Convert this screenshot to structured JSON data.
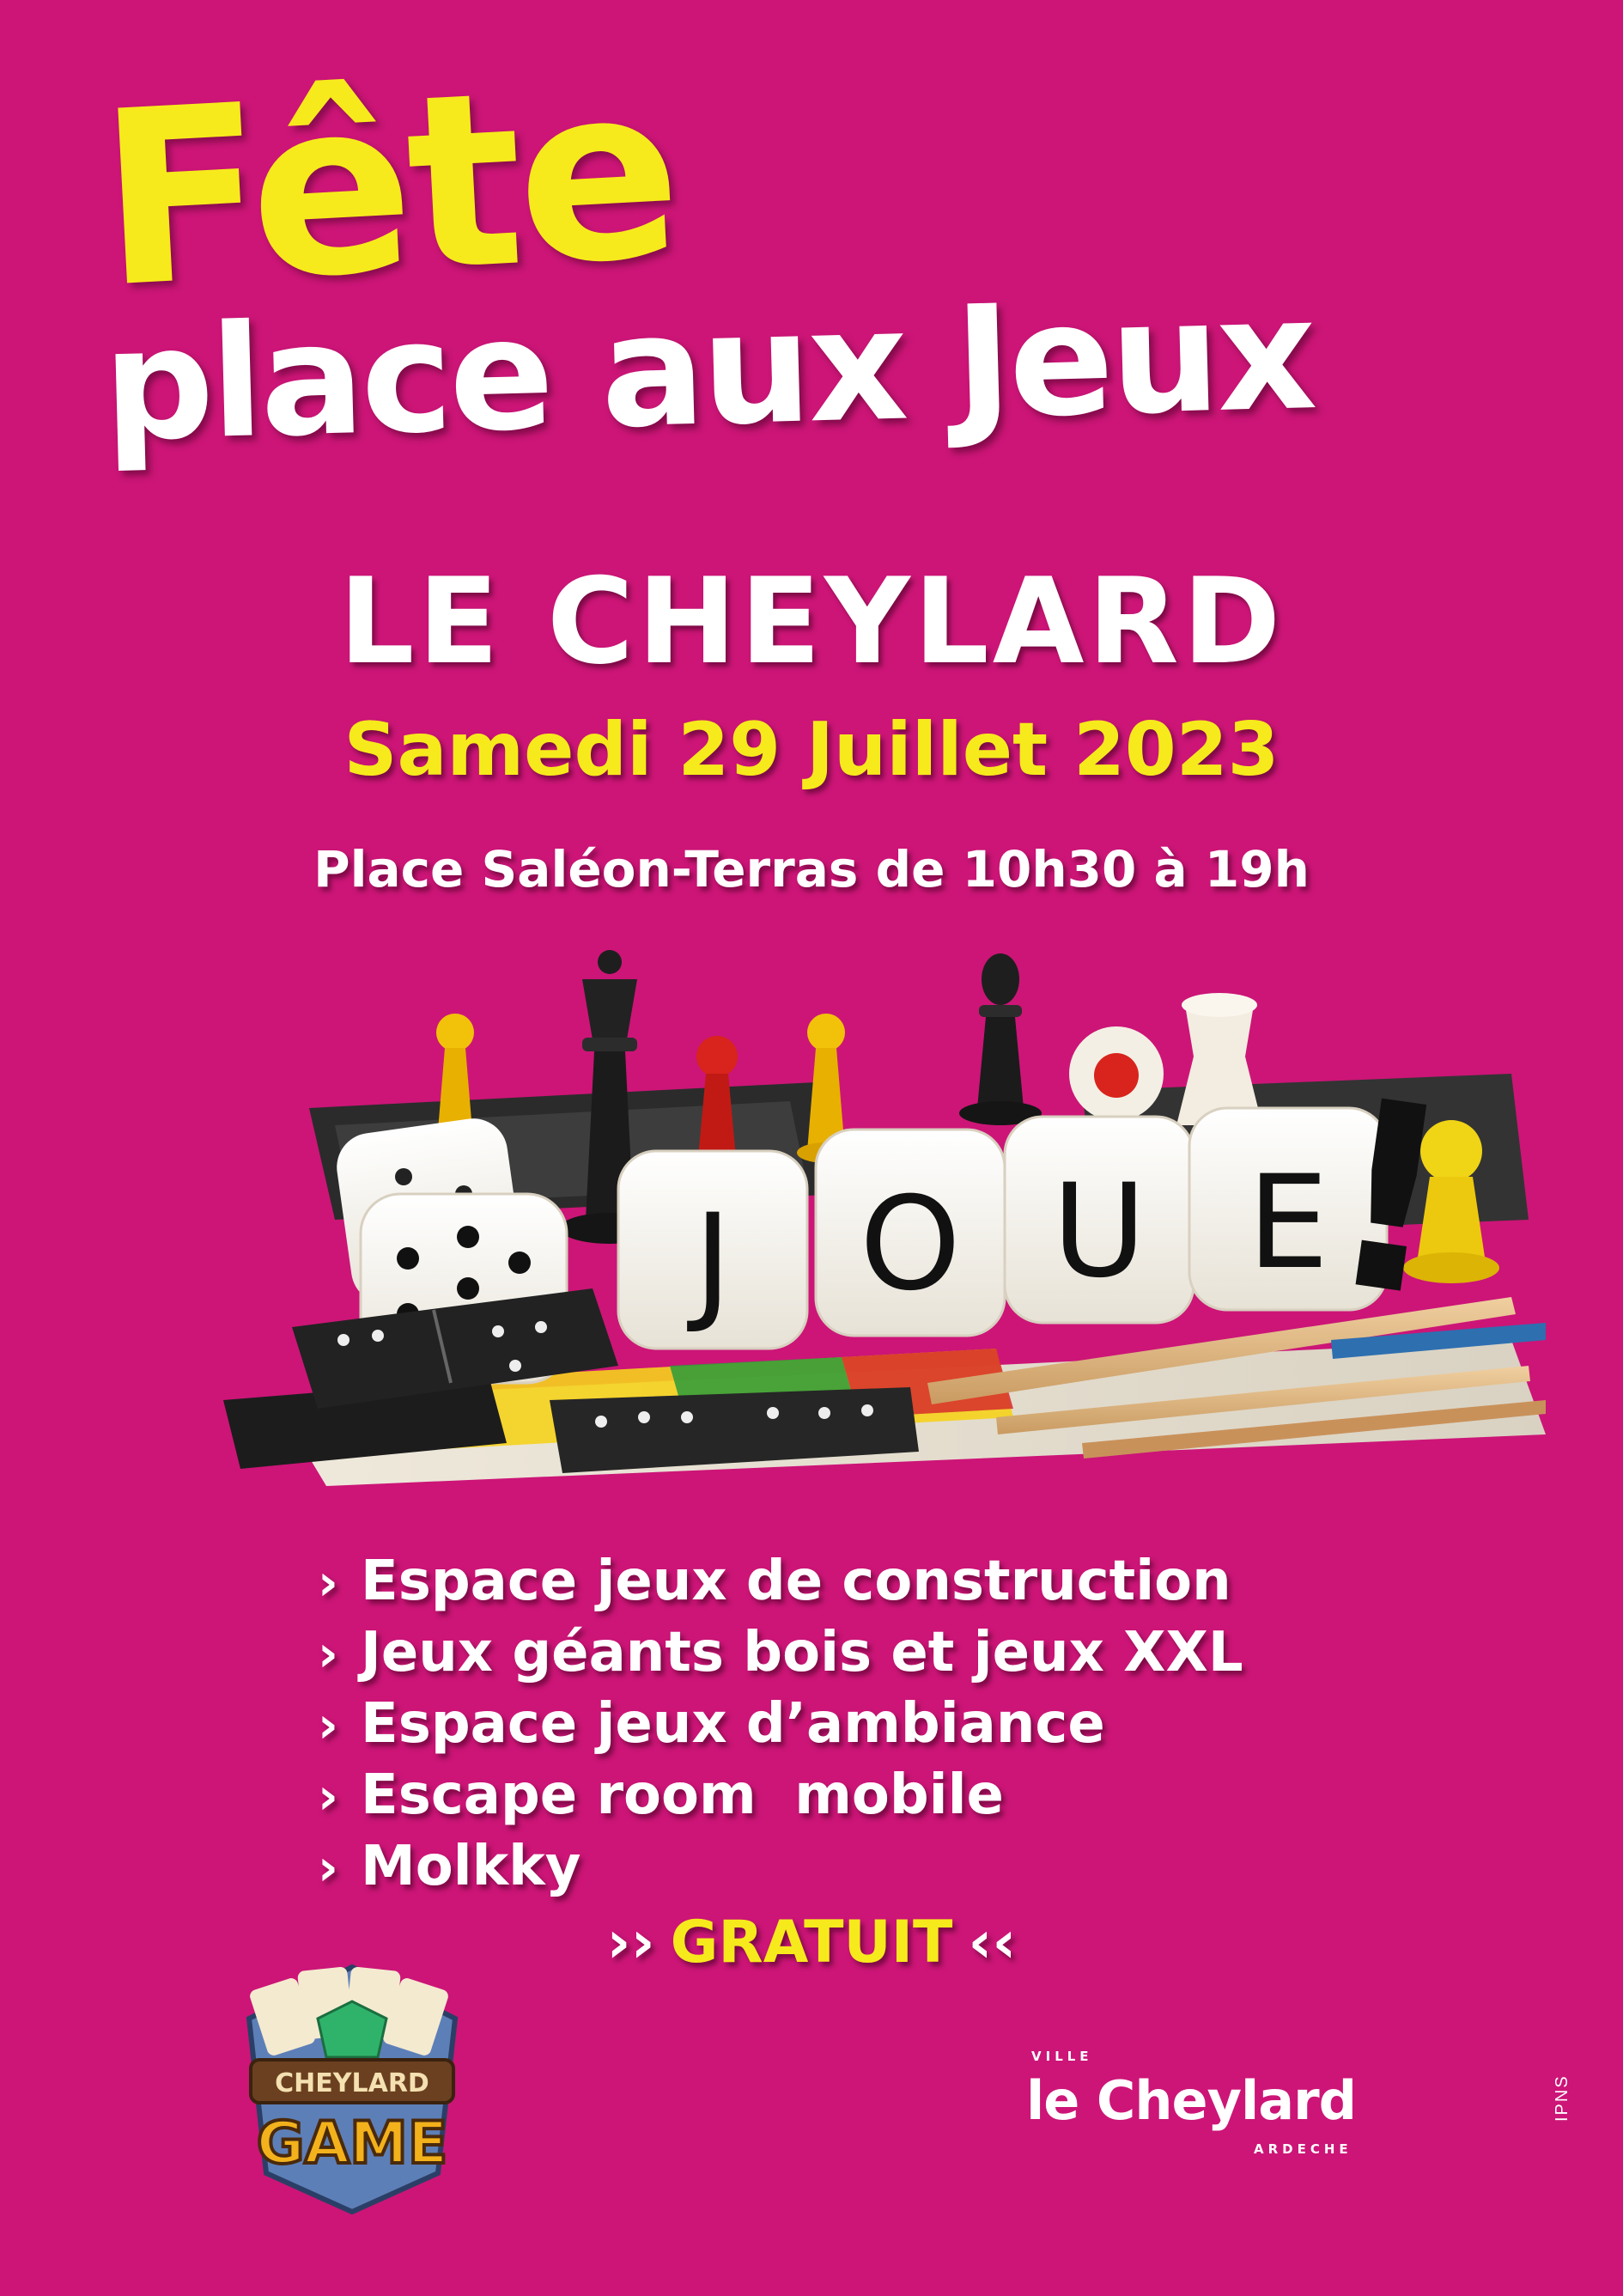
{
  "header": {
    "title_line1": "Fête",
    "title_line2": "place aux Jeux"
  },
  "event": {
    "town": "LE CHEYLARD",
    "date": "Samedi 29 Juillet 2023",
    "location": "Place Saléon-Terras de 10h30 à 19h"
  },
  "illustration": {
    "dice_letters": [
      "J",
      "O",
      "U",
      "E"
    ],
    "exclamation": "!"
  },
  "activities": {
    "bullet": "›",
    "items": [
      "Espace jeux de construction",
      "Jeux géants bois et jeux XXL",
      "Espace jeux d’ambiance",
      "Escape room  mobile",
      "Molkky"
    ]
  },
  "price": {
    "open_quote": "››",
    "label": "GRATUIT",
    "close_quote": "‹‹"
  },
  "logos": {
    "game_logo_line1": "CHEYLARD",
    "game_logo_line2": "GAME",
    "city_logo_top": "VILLE",
    "city_logo_name": "le Cheylard",
    "city_logo_bottom": "ARDECHE"
  },
  "footer": {
    "print_mention": "IPNS"
  },
  "colors": {
    "background": "#cc1577",
    "yellow": "#f7ea1c",
    "white": "#ffffff"
  }
}
